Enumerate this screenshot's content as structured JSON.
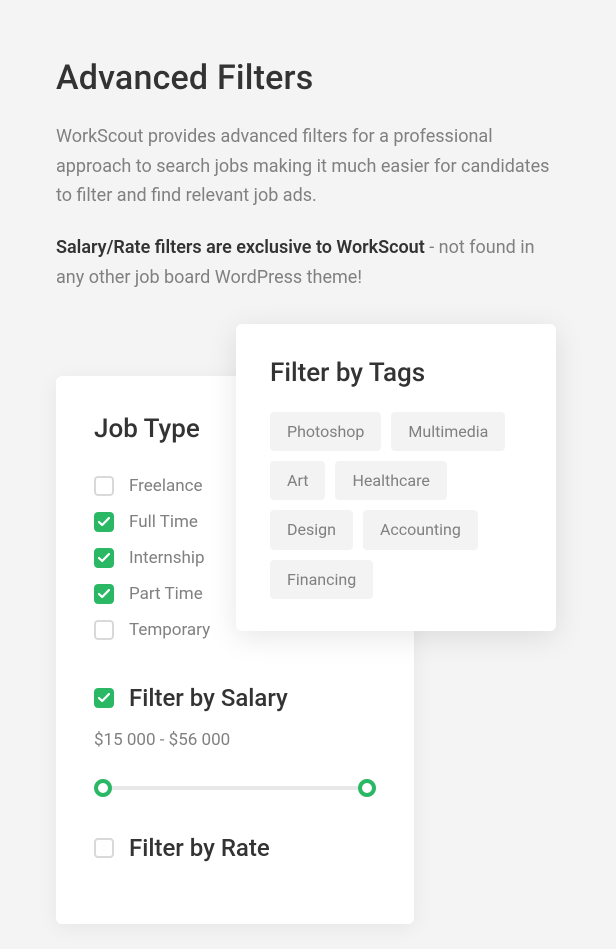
{
  "header": {
    "title": "Advanced Filters",
    "intro": "WorkScout provides advanced filters for a professional approach to search jobs making it much easier for candidates to filter and find relevant job ads.",
    "highlight_strong": "Salary/Rate filters are exclusive to WorkScout",
    "highlight_rest": " - not found in any other job board WordPress theme!"
  },
  "jobType": {
    "title": "Job Type",
    "items": [
      {
        "label": "Freelance",
        "checked": false
      },
      {
        "label": "Full Time",
        "checked": true
      },
      {
        "label": "Internship",
        "checked": true
      },
      {
        "label": "Part Time",
        "checked": true
      },
      {
        "label": "Temporary",
        "checked": false
      }
    ]
  },
  "salary": {
    "title": "Filter by Salary",
    "checked": true,
    "range_text": "$15 000 - $56 000"
  },
  "rate": {
    "title": "Filter by Rate",
    "checked": false
  },
  "tags": {
    "title": "Filter by Tags",
    "items": [
      "Photoshop",
      "Multimedia",
      "Art",
      "Healthcare",
      "Design",
      "Accounting",
      "Financing"
    ]
  },
  "colors": {
    "accent": "#2ab864"
  }
}
